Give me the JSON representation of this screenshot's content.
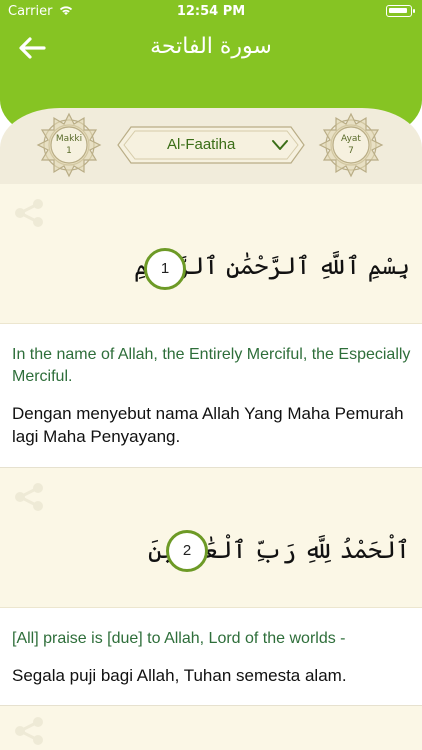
{
  "status": {
    "carrier": "Carrier",
    "time": "12:54 PM"
  },
  "header": {
    "title": "سورة الفاتحة"
  },
  "band": {
    "left_medallion": {
      "line1": "Makki",
      "line2": "1"
    },
    "right_medallion": {
      "line1": "Ayat",
      "line2": "7"
    },
    "surah_selected": "Al-Faatiha"
  },
  "verses": [
    {
      "arabic": "بِسْمِ ٱللَّهِ ٱلرَّحْمَٰنِ ٱلرَّحِيمِ",
      "number": "1",
      "english": "In the name of Allah, the Entirely Merciful, the Especially Merciful.",
      "indonesian": "Dengan menyebut nama Allah Yang Maha Pemurah lagi Maha Penyayang."
    },
    {
      "arabic": "ٱلْحَمْدُ لِلَّهِ رَبِّ ٱلْعَٰلَمِينَ",
      "number": "2",
      "english": "[All] praise is [due] to Allah, Lord of the worlds -",
      "indonesian": "Segala puji bagi Allah, Tuhan semesta alam."
    }
  ],
  "colors": {
    "header_green": "#86c423",
    "band_cream": "#f1ecdb",
    "verse_bg": "#fbf7e6",
    "translation_green": "#2e6e3a"
  }
}
